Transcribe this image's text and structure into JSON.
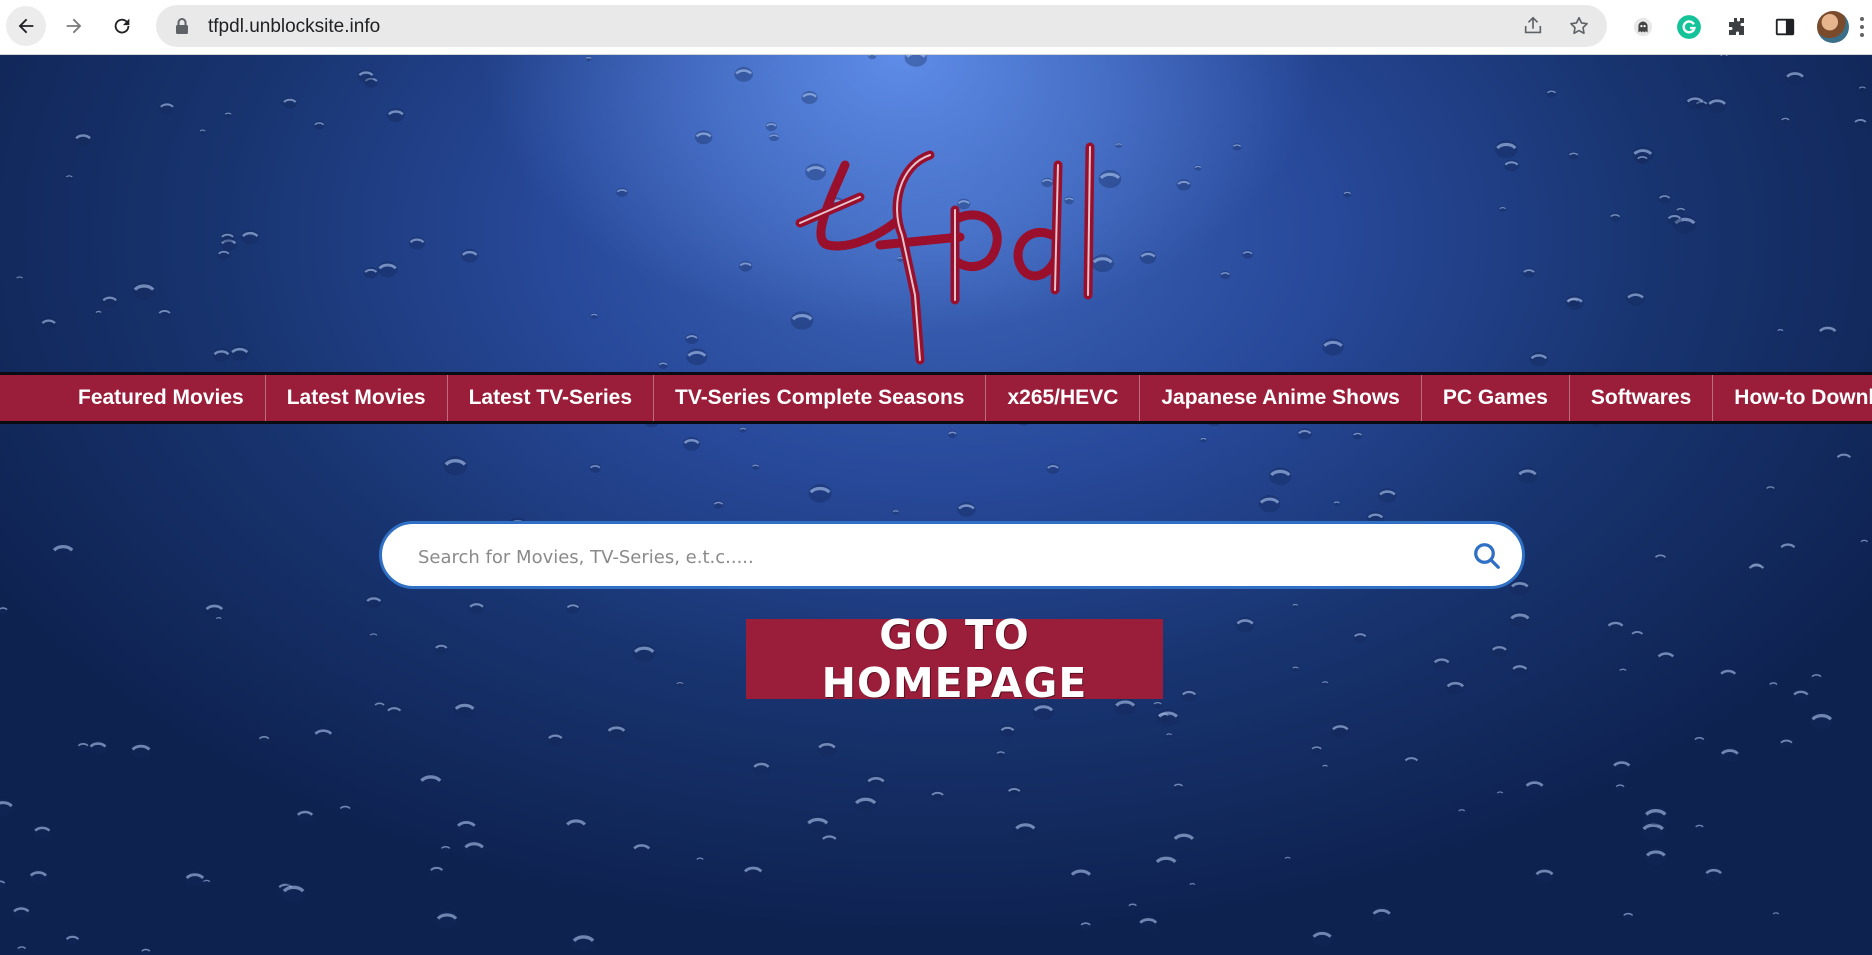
{
  "browser": {
    "url": "tfpdl.unblocksite.info",
    "icons": [
      "back-arrow-icon",
      "forward-arrow-icon",
      "reload-icon",
      "lock-icon",
      "share-icon",
      "star-icon",
      "ghost-extension-icon",
      "grammarly-icon",
      "puzzle-icon",
      "side-panel-icon",
      "profile-avatar"
    ]
  },
  "site": {
    "logo_text": "tfpdl",
    "nav": [
      {
        "label": "Featured Movies"
      },
      {
        "label": "Latest Movies"
      },
      {
        "label": "Latest TV-Series"
      },
      {
        "label": "TV-Series Complete Seasons"
      },
      {
        "label": "x265/HEVC"
      },
      {
        "label": "Japanese Anime Shows"
      },
      {
        "label": "PC Games"
      },
      {
        "label": "Softwares"
      },
      {
        "label": "How-to Download"
      }
    ],
    "search": {
      "placeholder": "Search for Movies, TV-Series, e.t.c.....",
      "value": ""
    },
    "home_button": "GO TO HOMEPAGE",
    "colors": {
      "accent": "#9a1d39",
      "background": "#28499a",
      "search_border": "#2f6fc4"
    }
  }
}
